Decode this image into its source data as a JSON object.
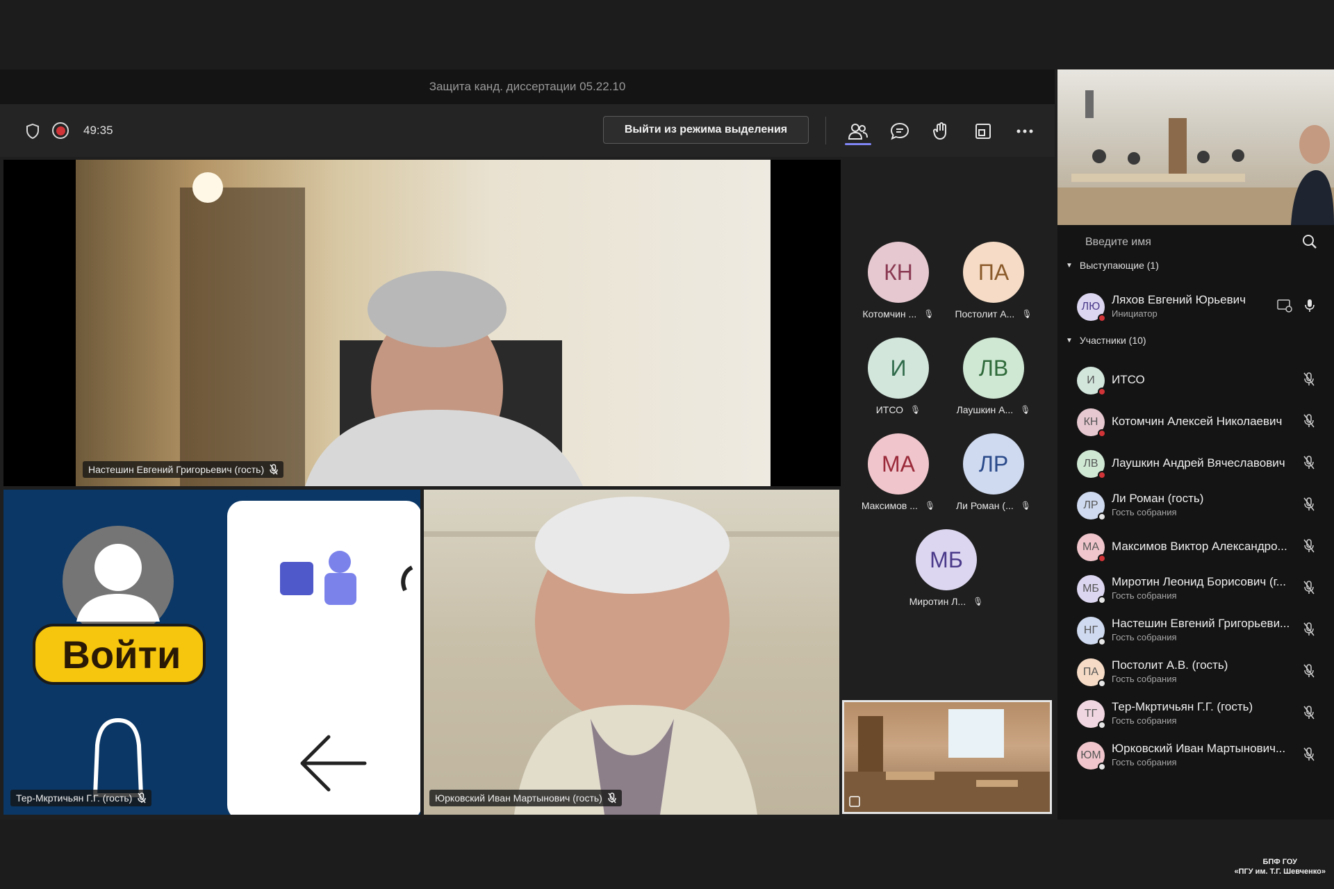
{
  "meeting": {
    "title": "Защита канд. диссертации 05.22.10",
    "timer": "49:35",
    "exit_spotlight_label": "Выйти из режима выделения"
  },
  "toolbar_icons": [
    "shield-icon",
    "record-icon",
    "people-icon",
    "chat-icon",
    "raise-hand-icon",
    "view-icon",
    "more-icon"
  ],
  "stage": {
    "spotlight_name": "Настешин Евгений Григорьевич (гость)",
    "tile_left_name": "Тер-Мкртичьян Г.Г. (гость)",
    "tile_left_login_label": "Войти",
    "tile_right_name": "Юрковский Иван Мартынович (гость)"
  },
  "grid_avatars": [
    {
      "initials": "КН",
      "name": "Котомчин ...",
      "color": "#e6c8d0"
    },
    {
      "initials": "ПА",
      "name": "Постолит А...",
      "color": "#f6dcc6"
    },
    {
      "initials": "И",
      "name": "ИТСО",
      "color": "#d2e6dc"
    },
    {
      "initials": "ЛВ",
      "name": "Лаушкин А...",
      "color": "#cfe8d4"
    },
    {
      "initials": "МА",
      "name": "Максимов ...",
      "color": "#f0c6cc"
    },
    {
      "initials": "ЛР",
      "name": "Ли Роман (...",
      "color": "#cfdaf0"
    },
    {
      "initials": "МБ",
      "name": "Миротин Л...",
      "color": "#ddd6f0"
    }
  ],
  "panel": {
    "search_placeholder": "Введите имя",
    "presenters_header": "Выступающие (1)",
    "participants_header": "Участники (10)",
    "presenters": [
      {
        "initials": "ЛЮ",
        "name": "Ляхов Евгений Юрьевич",
        "role": "Инициатор",
        "color": "#ddd6f0",
        "dot": "#d13438"
      }
    ],
    "participants": [
      {
        "initials": "И",
        "name": "ИТСО",
        "role": "",
        "color": "#d2e6dc",
        "dot": "#d13438"
      },
      {
        "initials": "КН",
        "name": "Котомчин Алексей Николаевич",
        "role": "",
        "color": "#e6c8d0",
        "dot": "#d13438"
      },
      {
        "initials": "ЛВ",
        "name": "Лаушкин Андрей Вячеславович",
        "role": "",
        "color": "#cfe8d4",
        "dot": "#d13438"
      },
      {
        "initials": "ЛР",
        "name": "Ли Роман (гость)",
        "role": "Гость собрания",
        "color": "#cfdaf0",
        "dot": "#e6e6e6"
      },
      {
        "initials": "МА",
        "name": "Максимов Виктор Александро...",
        "role": "",
        "color": "#f0c6cc",
        "dot": "#d13438"
      },
      {
        "initials": "МБ",
        "name": "Миротин Леонид Борисович (г...",
        "role": "Гость собрания",
        "color": "#ddd6f0",
        "dot": "#e6e6e6"
      },
      {
        "initials": "НГ",
        "name": "Настешин Евгений Григорьеви...",
        "role": "Гость собрания",
        "color": "#cfdaf0",
        "dot": "#e6e6e6"
      },
      {
        "initials": "ПА",
        "name": "Постолит А.В. (гость)",
        "role": "Гость собрания",
        "color": "#f6dcc6",
        "dot": "#e6e6e6"
      },
      {
        "initials": "ТГ",
        "name": "Тер-Мкртичьян Г.Г. (гость)",
        "role": "Гость собрания",
        "color": "#f0d6e0",
        "dot": "#e6e6e6"
      },
      {
        "initials": "ЮМ",
        "name": "Юрковский Иван Мартынович...",
        "role": "Гость собрания",
        "color": "#f0c6cc",
        "dot": "#e6e6e6"
      }
    ]
  },
  "watermark": {
    "line1": "БПФ ГОУ",
    "line2": "«ПГУ им. Т.Г. Шевченко»"
  }
}
